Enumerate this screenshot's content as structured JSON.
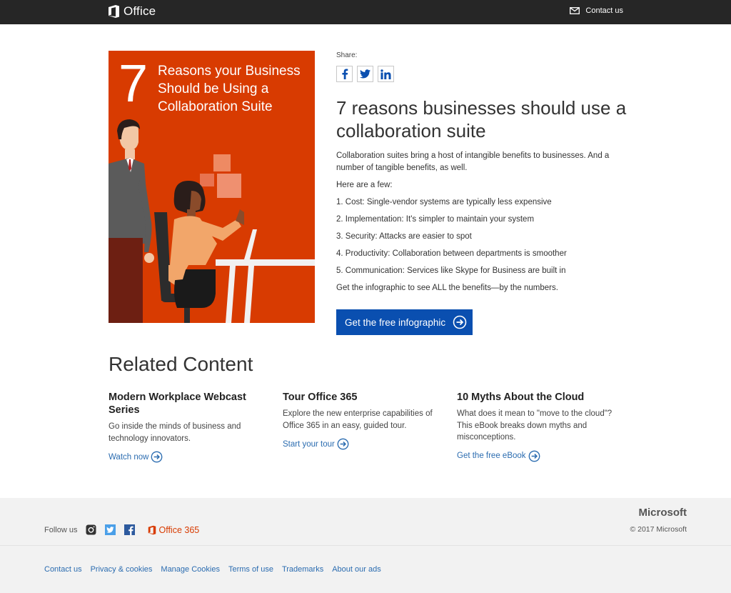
{
  "header": {
    "brand": "Office",
    "contact": "Contact us"
  },
  "hero": {
    "number": "7",
    "title": "Reasons your Business Should be Using a Collaboration Suite"
  },
  "share": {
    "label": "Share:",
    "icons": [
      "facebook-icon",
      "twitter-icon",
      "linkedin-icon"
    ]
  },
  "article": {
    "headline": "7 reasons businesses should use a collaboration suite",
    "intro": "Collaboration suites bring a host of intangible benefits to businesses. And a number of tangible benefits, as well.",
    "here": "Here are a few:",
    "items": [
      "1. Cost: Single-vendor systems are typically less expensive",
      "2. Implementation: It's simpler to maintain your system",
      "3. Security: Attacks are easier to spot",
      "4. Productivity: Collaboration between departments is smoother",
      "5. Communication: Services like Skype for Business are built in"
    ],
    "outro": "Get the infographic to see ALL the benefits—by the numbers.",
    "cta": "Get the free infographic"
  },
  "related": {
    "title": "Related Content",
    "cards": [
      {
        "title": "Modern Workplace Webcast Series",
        "desc": "Go inside the minds of business and technology innovators.",
        "link": "Watch now"
      },
      {
        "title": "Tour Office 365",
        "desc": "Explore the new enterprise capabilities of Office 365 in an easy, guided tour.",
        "link": "Start your tour"
      },
      {
        "title": "10 Myths About the Cloud",
        "desc": "What does it mean to \"move to the cloud\"? This eBook breaks down myths and misconceptions.",
        "link": "Get the free eBook"
      }
    ]
  },
  "footer": {
    "follow": "Follow us",
    "o365": "Office 365",
    "microsoft": "Microsoft",
    "copyright": "© 2017 Microsoft",
    "links": [
      "Contact us",
      "Privacy & cookies",
      "Manage Cookies",
      "Terms of use",
      "Trademarks",
      "About our ads"
    ]
  },
  "colors": {
    "accent": "#d83b01",
    "cta": "#0a4fb0",
    "link": "#2b6cb0",
    "topbar": "#262626"
  }
}
